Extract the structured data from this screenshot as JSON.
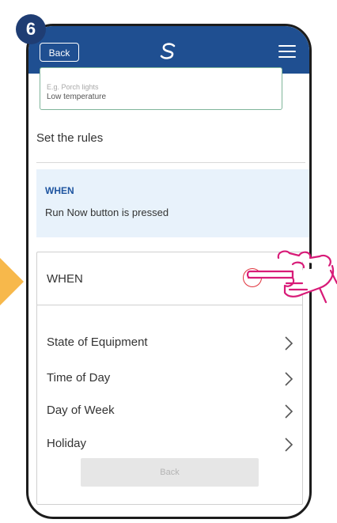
{
  "step": {
    "number": "6"
  },
  "header": {
    "back_label": "Back",
    "logo_icon": "salus-logo-icon",
    "menu_icon": "hamburger-menu-icon"
  },
  "name_field": {
    "placeholder": "E.g. Porch lights",
    "value": "Low temperature"
  },
  "rules": {
    "section_title": "Set the rules",
    "summary": {
      "heading": "WHEN",
      "text": "Run Now button is pressed"
    }
  },
  "when_panel": {
    "title": "WHEN",
    "remove_icon": "minus-circle-icon",
    "options": [
      {
        "label": "State of Equipment",
        "icon": "chevron-right-icon"
      },
      {
        "label": "Time of Day",
        "icon": "chevron-right-icon"
      },
      {
        "label": "Day of Week",
        "icon": "chevron-right-icon"
      },
      {
        "label": "Holiday",
        "icon": "chevron-right-icon"
      }
    ],
    "back_label": "Back"
  },
  "colors": {
    "header_blue": "#1f4f91",
    "badge_navy": "#1f3d73",
    "accent_blue": "#1f55a0",
    "summary_background": "#e8f2fb",
    "remove_red": "#e0323c",
    "hand_magenta": "#d81b78",
    "arrow_orange": "#f7b84b",
    "input_border_green": "#7fb59a"
  }
}
